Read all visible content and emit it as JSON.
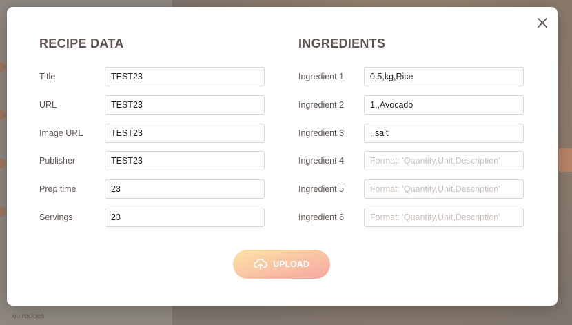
{
  "background": {
    "footer_text": "ou recipes"
  },
  "modal": {
    "close_icon": "close-icon",
    "recipe": {
      "heading": "RECIPE DATA",
      "fields": [
        {
          "label": "Title",
          "value": "TEST23",
          "placeholder": ""
        },
        {
          "label": "URL",
          "value": "TEST23",
          "placeholder": ""
        },
        {
          "label": "Image URL",
          "value": "TEST23",
          "placeholder": ""
        },
        {
          "label": "Publisher",
          "value": "TEST23",
          "placeholder": ""
        },
        {
          "label": "Prep time",
          "value": "23",
          "placeholder": ""
        },
        {
          "label": "Servings",
          "value": "23",
          "placeholder": ""
        }
      ]
    },
    "ingredients": {
      "heading": "INGREDIENTS",
      "fields": [
        {
          "label": "Ingredient 1",
          "value": "0.5,kg,Rice",
          "placeholder": "Format: 'Quantity,Unit,Description'"
        },
        {
          "label": "Ingredient 2",
          "value": "1,,Avocado",
          "placeholder": "Format: 'Quantity,Unit,Description'"
        },
        {
          "label": "Ingredient 3",
          "value": ",,salt",
          "placeholder": "Format: 'Quantity,Unit,Description'"
        },
        {
          "label": "Ingredient 4",
          "value": "",
          "placeholder": "Format: 'Quantity,Unit,Description'"
        },
        {
          "label": "Ingredient 5",
          "value": "",
          "placeholder": "Format: 'Quantity,Unit,Description'"
        },
        {
          "label": "Ingredient 6",
          "value": "",
          "placeholder": "Format: 'Quantity,Unit,Description'"
        }
      ]
    },
    "upload": {
      "label": "UPLOAD",
      "icon": "cloud-upload-icon"
    }
  },
  "colors": {
    "gradient_start": "#fbdb89",
    "gradient_end": "#f48982",
    "text": "#615551",
    "overlay": "#8a827b"
  }
}
